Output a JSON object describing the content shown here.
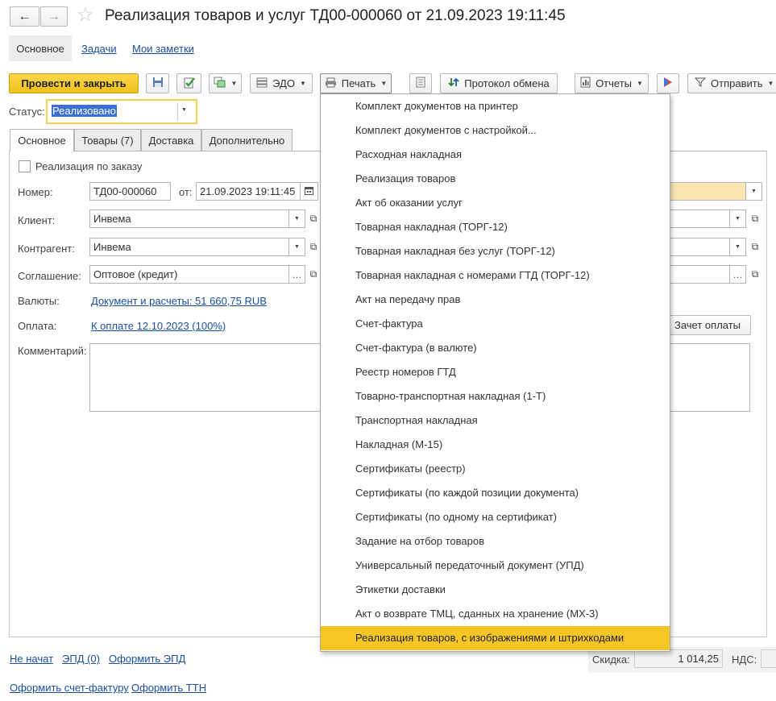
{
  "window": {
    "title": "Реализация товаров и услуг ТД00-000060 от 21.09.2023 19:11:45"
  },
  "nav_tabs": [
    "Основное",
    "Задачи",
    "Мои заметки"
  ],
  "toolbar": {
    "post_close": "Провести и закрыть",
    "edo": "ЭДО",
    "print": "Печать",
    "exchange_log": "Протокол обмена",
    "reports": "Отчеты",
    "send": "Отправить"
  },
  "status": {
    "label": "Статус:",
    "value": "Реализовано"
  },
  "form_tabs": [
    "Основное",
    "Товары (7)",
    "Доставка",
    "Дополнительно"
  ],
  "form": {
    "by_order": "Реализация по заказу",
    "number_label": "Номер:",
    "number": "ТД00-000060",
    "date_label": "от:",
    "date": "21.09.2023 19:11:45",
    "client_label": "Клиент:",
    "client": "Инвема",
    "counterparty_label": "Контрагент:",
    "counterparty": "Инвема",
    "agreement_label": "Соглашение:",
    "agreement": "Оптовое (кредит)",
    "currency_label": "Валюты:",
    "currency_link": "Документ и расчеты: 51 660,75 RUB",
    "payment_label": "Оплата:",
    "payment_link": "К оплате 12.10.2023 (100%)",
    "payment_offset": "Зачет оплаты",
    "comment_label": "Комментарий:",
    "comment": ""
  },
  "print_menu": {
    "items": [
      "Комплект документов на принтер",
      "Комплект документов с настройкой...",
      "Расходная накладная",
      "Реализация товаров",
      "Акт об оказании услуг",
      "Товарная накладная (ТОРГ-12)",
      "Товарная накладная без услуг (ТОРГ-12)",
      "Товарная накладная с номерами ГТД (ТОРГ-12)",
      "Акт на передачу прав",
      "Счет-фактура",
      "Счет-фактура (в валюте)",
      "Реестр номеров ГТД",
      "Товарно-транспортная накладная (1-Т)",
      "Транспортная накладная",
      "Накладная (М-15)",
      "Сертификаты (реестр)",
      "Сертификаты (по каждой позиции документа)",
      "Сертификаты (по одному на сертификат)",
      "Задание на отбор товаров",
      "Универсальный передаточный документ (УПД)",
      "Этикетки доставки",
      "Акт о возврате ТМЦ, сданных на хранение (МХ-3)",
      "Реализация товаров, с изображениями и штрихкодами"
    ],
    "highlighted_index": 22
  },
  "footer": {
    "not_started": "Не начат",
    "epd": "ЭПД (0)",
    "make_epd": "Оформить ЭПД",
    "make_invoice": "Оформить счет-фактуру",
    "make_ttn": "Оформить ТТН",
    "discount_label": "Скидка:",
    "discount": "1 014,25",
    "vat_label": "НДС:"
  },
  "colors": {
    "accent_yellow": "#f6c624",
    "link_blue": "#1a4fa0",
    "highlight_field": "#fbe6b4"
  },
  "icons": [
    "back-arrow-icon",
    "forward-arrow-icon",
    "star-icon",
    "save-icon",
    "post-icon",
    "create-based-icon",
    "edo-icon",
    "printer-icon",
    "list-icon",
    "exchange-icon",
    "reports-icon",
    "bitrix-icon",
    "send-icon",
    "calendar-icon",
    "open-icon",
    "ellipsis-icon"
  ]
}
